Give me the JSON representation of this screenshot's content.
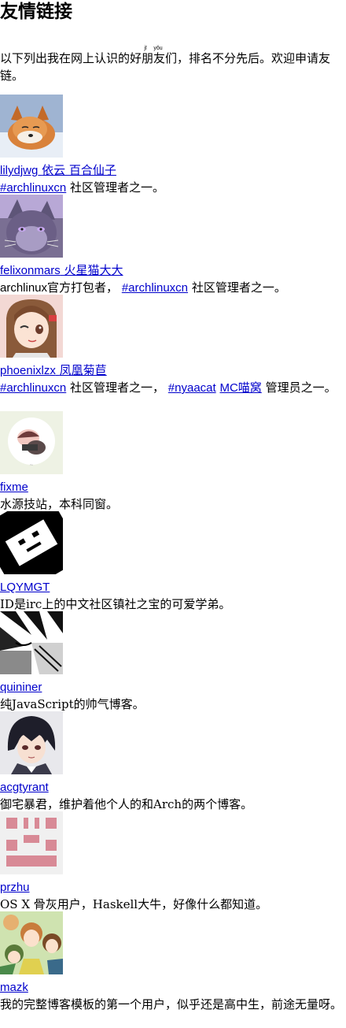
{
  "page": {
    "title": "友情链接",
    "intro_before": "以下列出我在网上认识的好",
    "intro_ruby_base": "朋友",
    "intro_ruby_text": "jī yǒu",
    "intro_after": "们，排名不分先后。欢迎申请友链。"
  },
  "friends": [
    {
      "handle": "lilydjwg",
      "nick": "依云 百合仙子",
      "desc_links": [
        "#archlinuxcn"
      ],
      "desc": "社区管理者之一。"
    },
    {
      "handle": "felixonmars",
      "nick": "火星猫大大",
      "desc_prefix": "archlinux官方打包者，",
      "desc_links": [
        "#archlinuxcn"
      ],
      "desc": "社区管理者之一。"
    },
    {
      "handle": "phoenixlzx",
      "nick": "凤凰菊苣",
      "desc_links": [
        "#archlinuxcn",
        "#nyaacat",
        "MC喵窝"
      ],
      "desc_mid": "社区管理者之一，",
      "desc": "管理员之一。"
    },
    {
      "handle": "fixme",
      "nick": "",
      "desc": "水源技站，本科同窗。"
    },
    {
      "handle": "LQYMGT",
      "nick": "",
      "desc": "ID是irc上的中文社区镇社之宝的可爱学弟。"
    },
    {
      "handle": "quininer",
      "nick": "",
      "desc": "纯JavaScript的帅气博客。"
    },
    {
      "handle": "acgtyrant",
      "nick": "",
      "desc": "御宅暴君，维护着他个人的和Arch的两个博客。"
    },
    {
      "handle": "przhu",
      "nick": "",
      "desc": "OS X 骨灰用户，Haskell大牛，好像什么都知道。"
    },
    {
      "handle": "mazk",
      "nick": "",
      "desc": "我的完整博客模板的第一个用户，似乎还是高中生，前途无量呀。"
    }
  ],
  "colors": {
    "link": "#0000cc",
    "przhu_identicon": "#d88a96"
  },
  "icons": {
    "fox": "fox-avatar",
    "cat": "cat-avatar",
    "anime_girl": "anime-girl-avatar",
    "sleeping_figure": "sleeping-figure-avatar",
    "box_face": "box-face-avatar",
    "sketch": "manga-sketch-avatar",
    "dark_hair_boy": "anime-boy-avatar",
    "identicon": "identicon-avatar",
    "anime_group": "anime-group-avatar"
  }
}
